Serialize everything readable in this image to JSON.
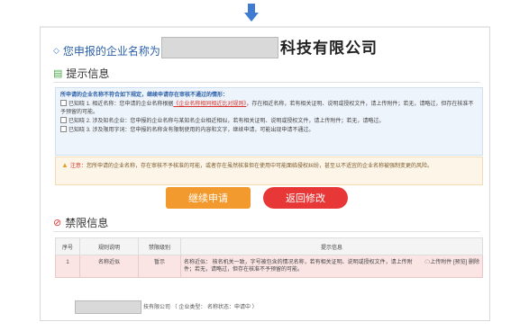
{
  "name_row": {
    "label": "您申报的企业名称为",
    "input_value": "",
    "suffix": "科技有限公司"
  },
  "tips": {
    "header": "提示信息",
    "title": "所申请的企业名称不符合如下规定，继续申请存在审核不通过的情形：",
    "items": [
      {
        "checkbox_label": "已知晓",
        "text_before": "1. 相近名称：您申请的企业名称根据",
        "link": "《企业名称相同相近比对规则》",
        "text_after": "，存在相近名称，若有相关证明、说明或授权文件，请上传附件；若无，请略过，但存在核准不予预留的可能。"
      },
      {
        "checkbox_label": "已知晓",
        "text": "2. 涉及知名企业：您申报的企业名称与某知名企业相近相似，若有相关证明、说明或授权文件，请上传附件；若无，请略过。"
      },
      {
        "checkbox_label": "已知晓",
        "text": "3. 涉及限用字词：您申报的名称含有限制使用的内容和文字，继续申请，可能出现申请不通过。"
      }
    ]
  },
  "warning": {
    "prefix": "注意：",
    "text": "您所申请的企业名称，存在审核不予核准的可能，或者存在虽然核准但在使用中可能面临侵权纠纷，甚至以不适宜的企业名称被强制变更的风险。"
  },
  "buttons": {
    "continue": "继续申请",
    "back": "返回修改"
  },
  "restrict": {
    "header": "禁限信息",
    "columns": [
      "序号",
      "规则说明",
      "禁限级别",
      "提示信息"
    ],
    "rows": [
      {
        "no": "1",
        "rule": "名称近似",
        "level": "暂示",
        "info": "名称近似：\t核名机关一致，字号被包含的情况名称，若有相关证明、说明或授权文件，请上传附件；若无，请略过，但存在核准不予预留的可能。",
        "action_upload": "上传附件",
        "action_preview": "[预览]",
        "action_delete": "删除"
      }
    ]
  },
  "bottom": {
    "input_value": "",
    "text": "技有限公司 （ 企业类型： 名称状态：申请中 ）"
  }
}
